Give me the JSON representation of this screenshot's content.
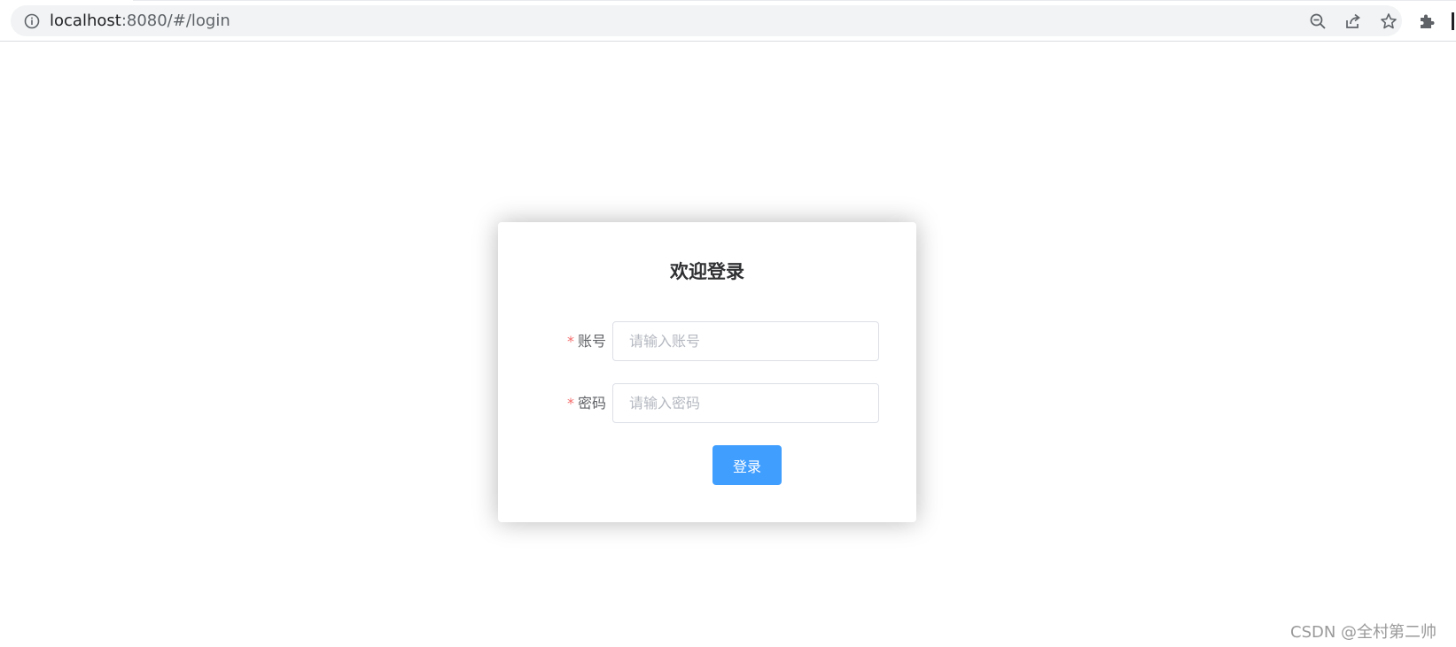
{
  "browser": {
    "url_host": "localhost",
    "url_rest": ":8080/#/login",
    "icons": [
      "info-icon",
      "zoom-out-icon",
      "share-icon",
      "star-icon",
      "extensions-icon"
    ]
  },
  "login": {
    "title": "欢迎登录",
    "account_label": "账号",
    "account_placeholder": "请输入账号",
    "account_value": "",
    "password_label": "密码",
    "password_placeholder": "请输入密码",
    "password_value": "",
    "required_mark": "*",
    "submit_label": "登录"
  },
  "watermark": "CSDN @全村第二帅",
  "colors": {
    "primary": "#409eff",
    "required": "#f56c6c",
    "title": "#303133",
    "label": "#606266"
  }
}
